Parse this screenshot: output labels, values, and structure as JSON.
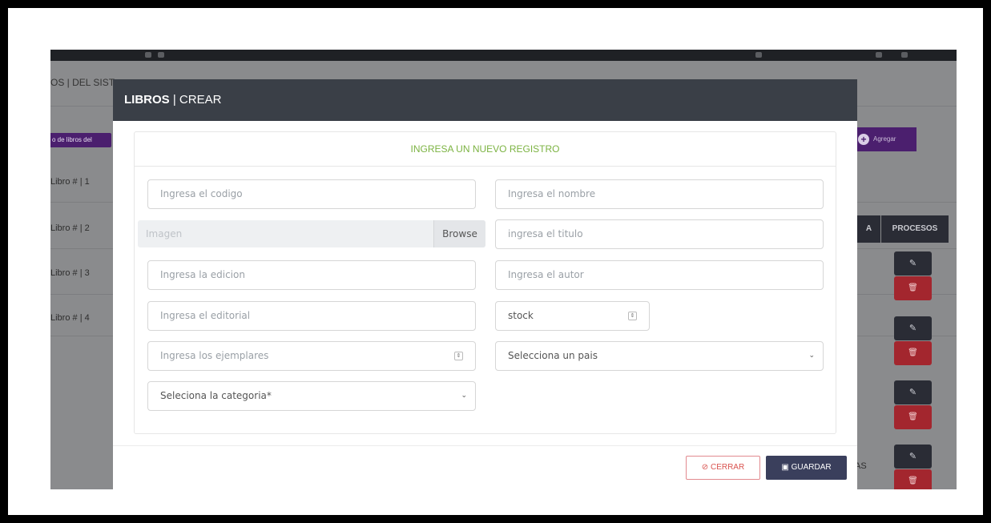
{
  "background": {
    "breadcrumb": "OS | DEL SIST",
    "list_pill": "o de libros del",
    "libros": [
      "Libro # | 1",
      "Libro # | 2",
      "Libro # | 3",
      "Libro # | 4"
    ],
    "add_button": "Agregar",
    "column_a": "A",
    "column_procesos": "PROCESOS",
    "edit_glyph": "✎",
    "delete_glyph": "🗑",
    "partial_text": "AS"
  },
  "modal": {
    "title_strong": "LIBROS",
    "title_rest": " | CREAR",
    "subtitle": "INGRESA UN NUEVO REGISTRO",
    "fields": {
      "codigo_placeholder": "Ingresa el codigo",
      "nombre_placeholder": "Ingresa el nombre",
      "imagen_placeholder": "Imagen",
      "browse_label": "Browse",
      "titulo_placeholder": "ingresa el titulo",
      "edicion_placeholder": "Ingresa la edicion",
      "autor_placeholder": "Ingresa el autor",
      "editorial_placeholder": "Ingresa el editorial",
      "stock_value": "stock",
      "ejemplares_placeholder": "Ingresa los ejemplares",
      "pais_selected": "Selecciona un pais",
      "categoria_selected": "Seleciona la categoria*"
    },
    "footer": {
      "cerrar_label": "CERRAR",
      "guardar_label": "GUARDAR"
    }
  },
  "colors": {
    "modal_header": "#3a3f47",
    "subtitle": "#7cb342",
    "brand_purple": "#4b1f6e",
    "danger": "#a3262e",
    "guardar": "#3a3f5c"
  }
}
